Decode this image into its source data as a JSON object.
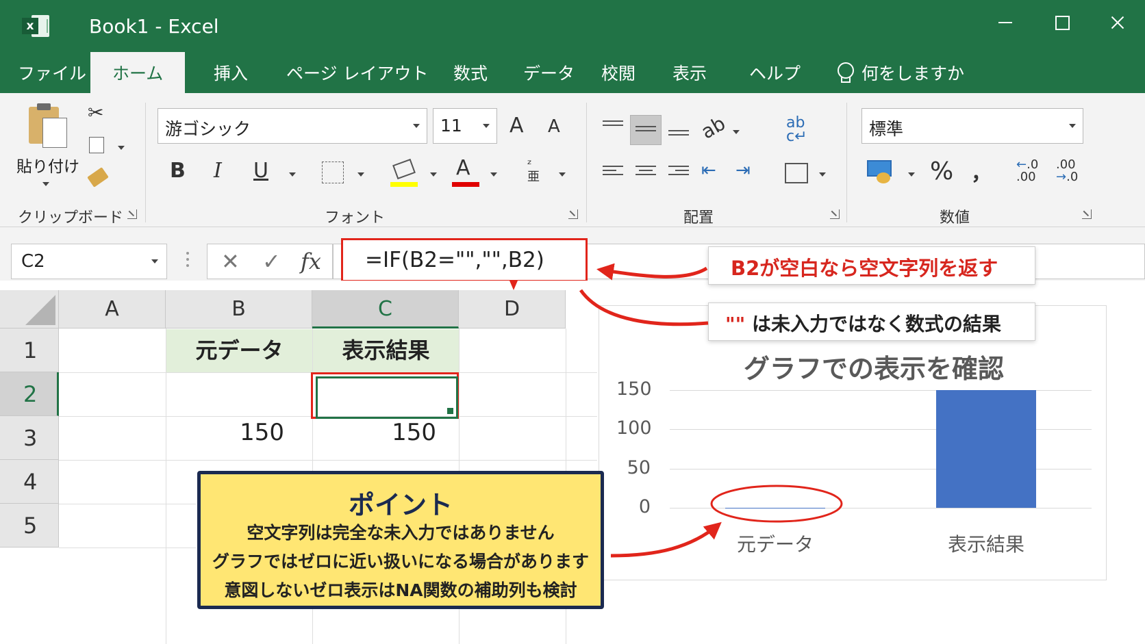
{
  "window": {
    "title": "Book1  -  Excel",
    "app_icon": "excel-icon"
  },
  "tabs": [
    {
      "label": "ファイル",
      "active": false
    },
    {
      "label": "ホーム",
      "active": true
    },
    {
      "label": "挿入",
      "active": false
    },
    {
      "label": "ページ レイアウト",
      "active": false
    },
    {
      "label": "数式",
      "active": false
    },
    {
      "label": "データ",
      "active": false
    },
    {
      "label": "校閲",
      "active": false
    },
    {
      "label": "表示",
      "active": false
    },
    {
      "label": "ヘルプ",
      "active": false
    }
  ],
  "tell_me": {
    "label": "何をしますか",
    "icon": "lightbulb-icon"
  },
  "ribbon": {
    "clipboard": {
      "paste_label": "貼り付け",
      "group_label": "クリップボード"
    },
    "font": {
      "font_name": "游ゴシック",
      "font_size": "11",
      "group_label": "フォント",
      "bold": "B",
      "italic": "I",
      "underline": "U",
      "grow": "A",
      "shrink": "A",
      "font_color_letter": "A",
      "highlight_color": "#ffff00",
      "font_color": "#e00000"
    },
    "alignment": {
      "group_label": "配置"
    },
    "number": {
      "format": "標準",
      "percent": "%",
      "comma": "，",
      "group_label": "数値"
    }
  },
  "formula_bar": {
    "name_box": "C2",
    "cancel": "✕",
    "enter": "✓",
    "fx": "fx",
    "formula": "=IF(B2=\"\",\"\",B2)"
  },
  "sheet": {
    "columns": [
      "A",
      "B",
      "C",
      "D"
    ],
    "rows": [
      "1",
      "2",
      "3",
      "4",
      "5"
    ],
    "cells": {
      "B1": "元データ",
      "C1": "表示結果",
      "B2": "",
      "C2": "",
      "B3": "150",
      "C3": "150"
    },
    "selected_cell": "C2"
  },
  "callouts": {
    "formula_note": "B2が空白なら空文字列を返す",
    "empty_string_quote": "\"\"",
    "empty_string_note": "は未入力ではなく数式の結果"
  },
  "point": {
    "title": "ポイント",
    "lines": [
      "空文字列は完全な未入力ではありません",
      "グラフではゼロに近い扱いになる場合があります",
      "意図しないゼロ表示はNA関数の補助列も検討"
    ]
  },
  "chart_data": {
    "type": "bar",
    "title": "グラフでの表示を確認",
    "categories": [
      "元データ",
      "表示結果"
    ],
    "values": [
      0,
      150
    ],
    "yticks": [
      "150",
      "100",
      "50",
      "0"
    ],
    "ylim": [
      0,
      150
    ],
    "bar_color": "#4472c4",
    "grid": true,
    "legend": "none"
  },
  "colors": {
    "accent": "#217346",
    "highlight_red": "#e1251b",
    "point_bg": "#ffe673",
    "point_border": "#1b2a50"
  }
}
